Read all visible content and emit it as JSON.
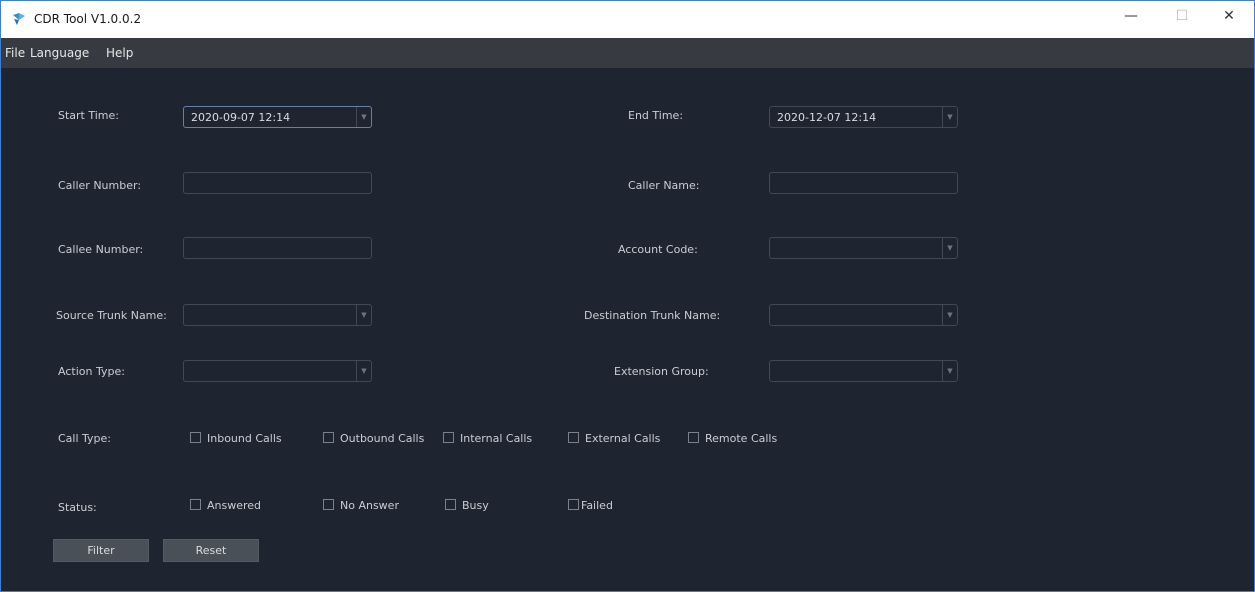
{
  "window": {
    "title": "CDR Tool V1.0.0.2",
    "controls": {
      "minimize": "—",
      "maximize": "☐",
      "close": "✕"
    }
  },
  "menu": [
    "File",
    "Language",
    "Help"
  ],
  "form": {
    "start_time": {
      "label": "Start Time:",
      "value": "2020-09-07 12:14"
    },
    "end_time": {
      "label": "End Time:",
      "value": "2020-12-07 12:14"
    },
    "caller_number": {
      "label": "Caller Number:",
      "value": ""
    },
    "caller_name": {
      "label": "Caller Name:",
      "value": ""
    },
    "callee_number": {
      "label": "Callee Number:",
      "value": ""
    },
    "account_code": {
      "label": "Account Code:",
      "value": ""
    },
    "source_trunk_name": {
      "label": "Source Trunk Name:",
      "value": ""
    },
    "destination_trunk_name": {
      "label": "Destination Trunk Name:",
      "value": ""
    },
    "action_type": {
      "label": "Action Type:",
      "value": ""
    },
    "extension_group": {
      "label": "Extension Group:",
      "value": ""
    },
    "call_type": {
      "label": "Call Type:",
      "options": [
        "Inbound Calls",
        "Outbound Calls",
        "Internal Calls",
        "External Calls",
        "Remote Calls"
      ]
    },
    "status": {
      "label": "Status:",
      "options": [
        "Answered",
        "No Answer",
        "Busy",
        "Failed"
      ]
    }
  },
  "buttons": {
    "filter": "Filter",
    "reset": "Reset"
  },
  "icons": {
    "app": "app-icon",
    "dropdown": "chevron-down-icon"
  },
  "colors": {
    "background": "#1f2530",
    "menubar": "#373b41",
    "text": "#c9cdd3",
    "button": "#4a5058"
  }
}
